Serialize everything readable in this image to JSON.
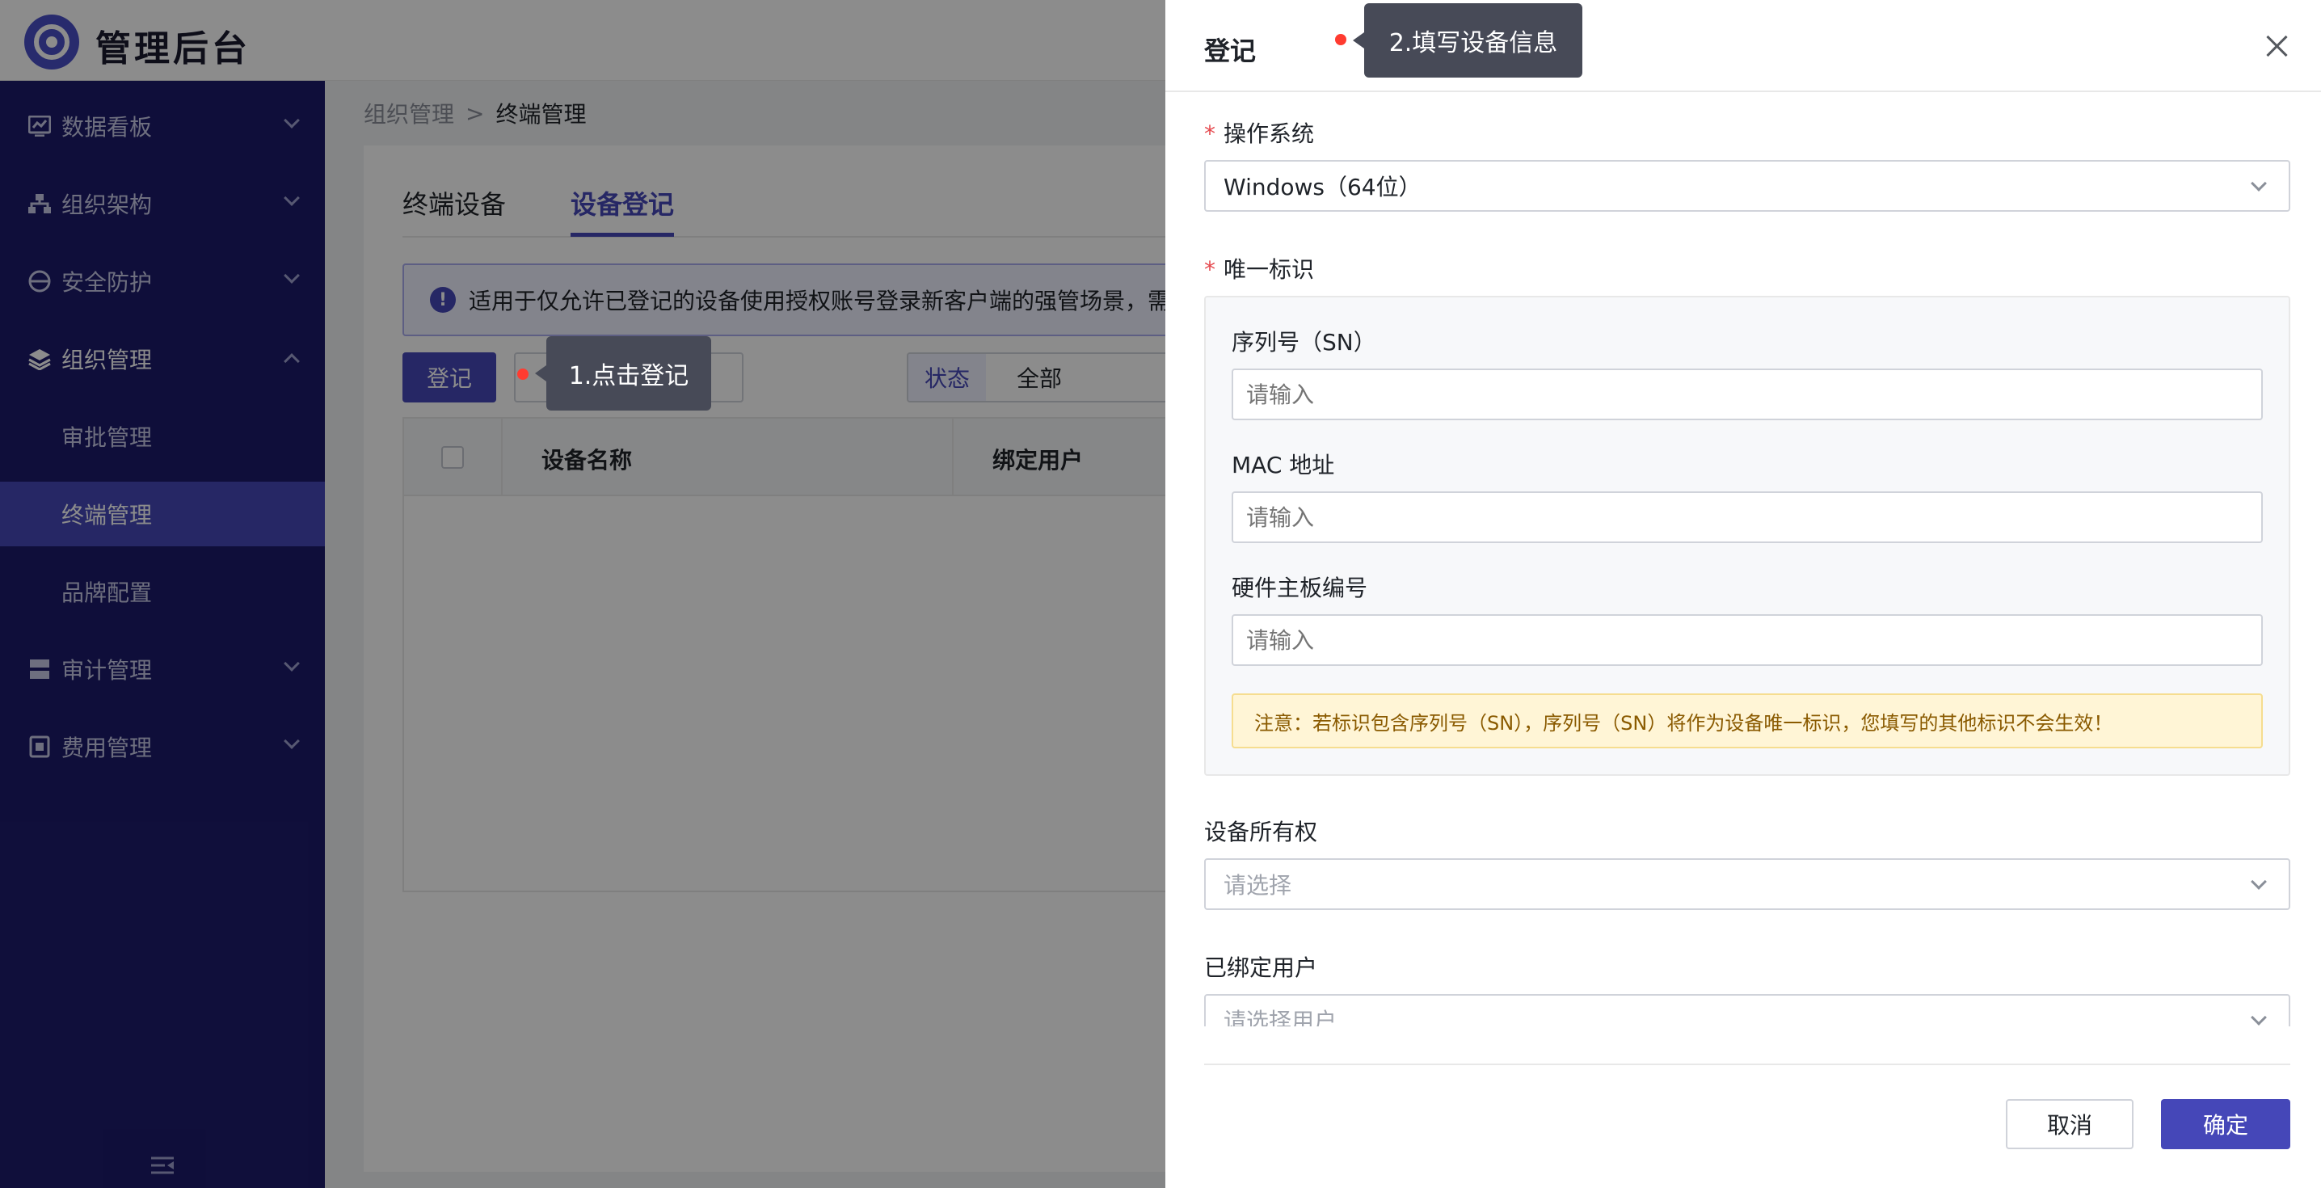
{
  "app": {
    "title": "管理后台"
  },
  "sidebar": {
    "items": [
      {
        "label": "数据看板",
        "icon": "chart-icon",
        "expanded": false
      },
      {
        "label": "组织架构",
        "icon": "org-tree-icon",
        "expanded": false
      },
      {
        "label": "安全防护",
        "icon": "shield-icon",
        "expanded": false
      },
      {
        "label": "组织管理",
        "icon": "layers-icon",
        "expanded": true,
        "children": [
          {
            "label": "审批管理",
            "selected": false
          },
          {
            "label": "终端管理",
            "selected": true
          },
          {
            "label": "品牌配置",
            "selected": false
          }
        ]
      },
      {
        "label": "审计管理",
        "icon": "server-icon",
        "expanded": false
      },
      {
        "label": "费用管理",
        "icon": "billing-icon",
        "expanded": false
      }
    ]
  },
  "breadcrumb": {
    "parent": "组织管理",
    "separator": ">",
    "current": "终端管理"
  },
  "main": {
    "tabs": [
      {
        "label": "终端设备",
        "active": false
      },
      {
        "label": "设备登记",
        "active": true
      }
    ],
    "alert_text": "适用于仅允许已登记的设备使用授权账号登录新客户端的强管场景，需",
    "register_button": "登记",
    "filter": {
      "label": "状态",
      "value": "全部"
    },
    "table": {
      "columns": [
        "设备名称",
        "绑定用户"
      ]
    }
  },
  "drawer": {
    "title": "登记",
    "os": {
      "label": "操作系统",
      "required": true,
      "value": "Windows（64位）"
    },
    "unique_id": {
      "label": "唯一标识",
      "required": true,
      "serial": {
        "label": "序列号（SN）",
        "placeholder": "请输入"
      },
      "mac": {
        "label": "MAC 地址",
        "placeholder": "请输入"
      },
      "board": {
        "label": "硬件主板编号",
        "placeholder": "请输入"
      },
      "notice": "注意：若标识包含序列号（SN），序列号（SN）将作为设备唯一标识，您填写的其他标识不会生效！"
    },
    "ownership": {
      "label": "设备所有权",
      "placeholder": "请选择"
    },
    "bound_user": {
      "label": "已绑定用户",
      "placeholder": "请选择用户"
    },
    "cancel_label": "取消",
    "confirm_label": "确定"
  },
  "hints": {
    "step1": "1.点击登记",
    "step2": "2.填写设备信息"
  },
  "colors": {
    "sidebar_bg": "#1d1b6b",
    "accent": "#4547b8",
    "hint_bg": "#474a57",
    "hint_dot": "#ff3b30",
    "required": "#e5484d"
  }
}
